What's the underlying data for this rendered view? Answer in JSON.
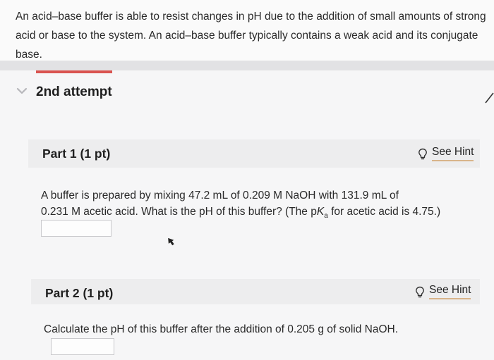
{
  "intro": {
    "text": "An acid–base buffer is able to resist changes in pH due to the addition of small amounts of strong acid or base to the system. An acid–base buffer typically contains a weak acid and its conjugate base."
  },
  "attempt": {
    "title": "2nd attempt",
    "accent_color": "#d9534f"
  },
  "part1": {
    "title": "Part 1 (1 pt)",
    "hint_label": "See Hint",
    "question_line1": "A buffer is prepared by mixing 47.2 mL of 0.209 M NaOH with 131.9 mL of",
    "question_line2_a": "0.231 M acetic acid. What is the pH of this buffer? (The p",
    "question_line2_k": "K",
    "question_line2_sub": "a",
    "question_line2_b": " for acetic acid is 4.75.)",
    "answer_value": ""
  },
  "part2": {
    "title": "Part 2 (1 pt)",
    "hint_label": "See Hint",
    "question": "Calculate the pH of this buffer after the addition of 0.205  g of solid NaOH.",
    "answer_value": ""
  },
  "icons": {
    "expand": "chevron-down-icon",
    "hint": "lightbulb-icon",
    "pointer": "mouse-cursor-icon"
  }
}
